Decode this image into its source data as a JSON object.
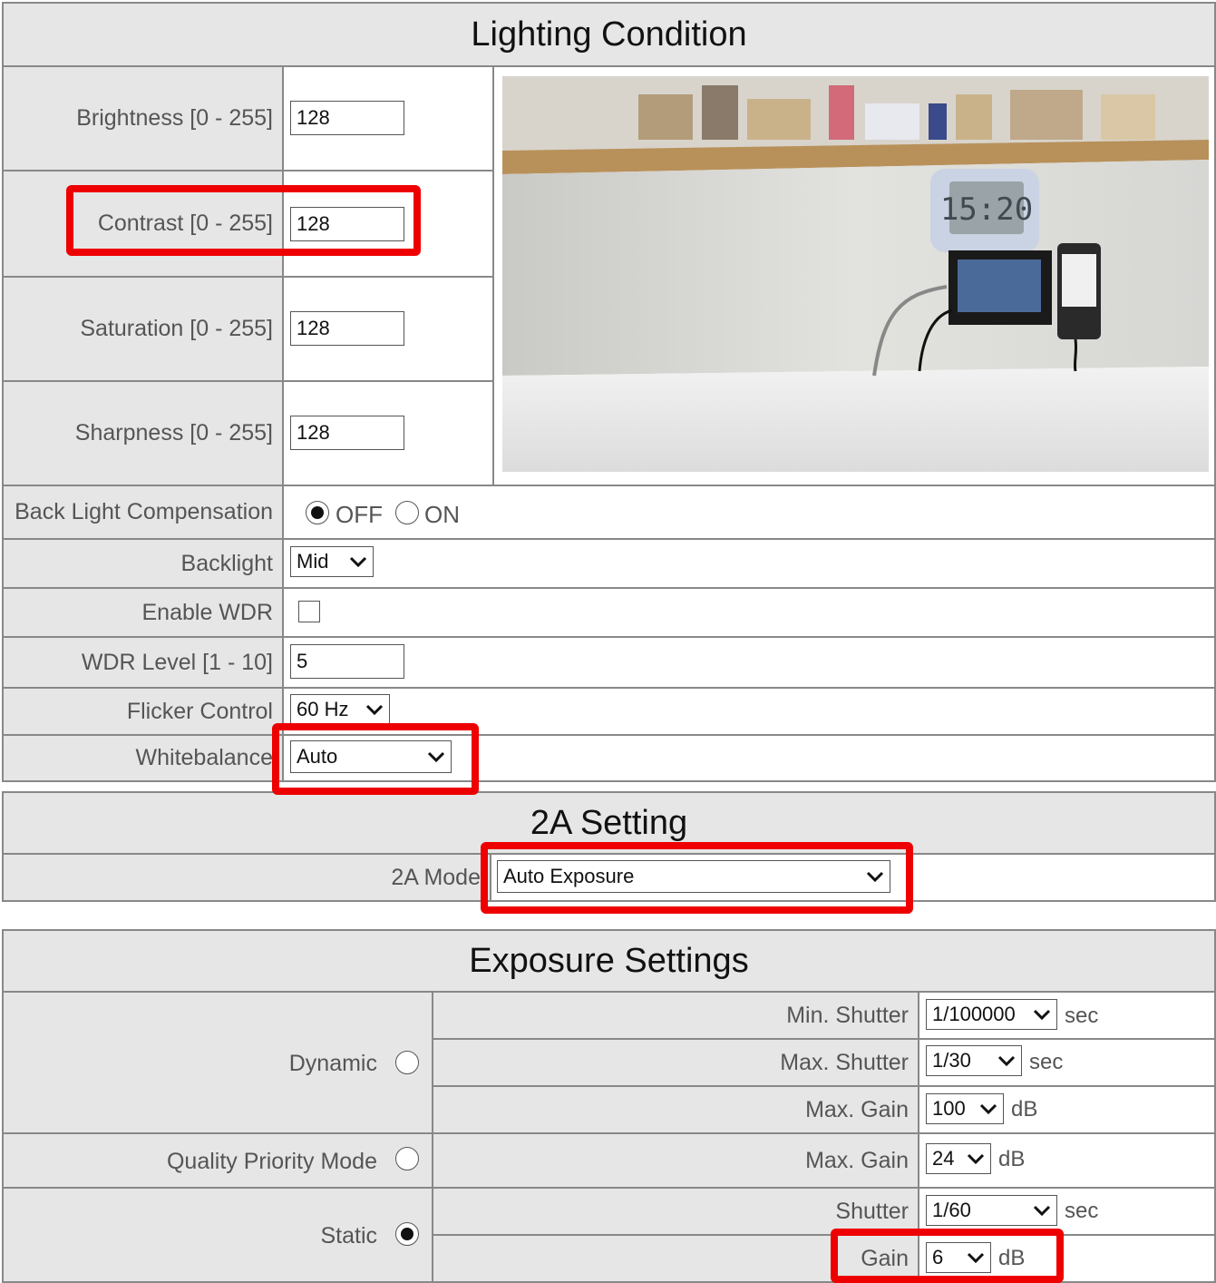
{
  "lighting": {
    "title": "Lighting Condition",
    "brightness": {
      "label": "Brightness [0 - 255]",
      "value": "128"
    },
    "contrast": {
      "label": "Contrast [0 - 255]",
      "value": "128"
    },
    "saturation": {
      "label": "Saturation [0 - 255]",
      "value": "128"
    },
    "sharpness": {
      "label": "Sharpness [0 - 255]",
      "value": "128"
    },
    "blc": {
      "label": "Back Light Compensation",
      "off_label": "OFF",
      "on_label": "ON",
      "selected": "OFF"
    },
    "backlight": {
      "label": "Backlight",
      "value": "Mid"
    },
    "wdr": {
      "label": "Enable WDR",
      "checked": false
    },
    "wdr_level": {
      "label": "WDR Level [1 - 10]",
      "value": "5"
    },
    "flicker": {
      "label": "Flicker Control",
      "value": "60 Hz"
    },
    "whitebalance": {
      "label": "Whitebalance",
      "value": "Auto"
    },
    "preview": {
      "clock_text": "15:20"
    }
  },
  "twoa": {
    "title": "2A Setting",
    "mode_label": "2A Mode",
    "mode_value": "Auto Exposure"
  },
  "exposure": {
    "title": "Exposure Settings",
    "dynamic": {
      "label": "Dynamic",
      "selected": false
    },
    "quality": {
      "label": "Quality Priority Mode",
      "selected": false
    },
    "static": {
      "label": "Static",
      "selected": true
    },
    "min_shutter": {
      "label": "Min. Shutter",
      "value": "1/100000",
      "unit": "sec"
    },
    "max_shutter": {
      "label": "Max. Shutter",
      "value": "1/30",
      "unit": "sec"
    },
    "dyn_max_gain": {
      "label": "Max. Gain",
      "value": "100",
      "unit": "dB"
    },
    "qp_max_gain": {
      "label": "Max. Gain",
      "value": "24",
      "unit": "dB"
    },
    "shutter": {
      "label": "Shutter",
      "value": "1/60",
      "unit": "sec"
    },
    "gain": {
      "label": "Gain",
      "value": "6",
      "unit": "dB"
    }
  },
  "colors": {
    "highlight": "#ee0000",
    "header_bg": "#e6e6e6",
    "border": "#888888"
  }
}
